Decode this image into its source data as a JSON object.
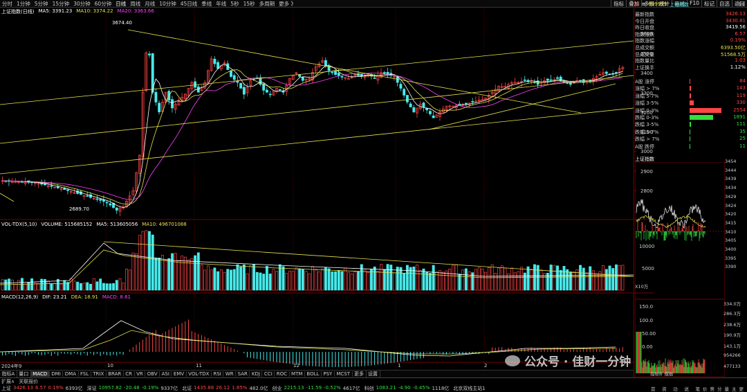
{
  "top_toolbar": {
    "periods": [
      "分时",
      "1分钟",
      "5分钟",
      "15分钟",
      "30分钟",
      "60分钟",
      "日线",
      "周线",
      "月线",
      "10分钟",
      "45日线",
      "季线",
      "年线",
      "5秒",
      "15秒",
      "多周期",
      "更多 》"
    ],
    "active": "日线",
    "right_buttons": [
      "指标",
      "叠加",
      "多股",
      "统计",
      "画线",
      "F10",
      "标记",
      "自选",
      "返回"
    ]
  },
  "main_chart": {
    "title": "上证指数(日线)",
    "ma5": "MA5: 3391.23",
    "ma10": "MA10: 3374.22",
    "ma20": "MA20: 3363.66",
    "high_label": "3674.40",
    "low_label": "2689.70",
    "y_ticks": [
      "3600",
      "3500",
      "3400",
      "3300",
      "3200",
      "3100",
      "3000",
      "2900",
      "2800"
    ]
  },
  "volume_chart": {
    "title": "VOL-TDX(5,10)",
    "volume": "VOLUME: 515685152",
    "ma5": "MA5: 513605056",
    "ma10": "MA10: 496701088",
    "y_ticks": [
      "10000",
      "5000"
    ],
    "unit": "X10万"
  },
  "macd_chart": {
    "title": "MACD(12,26,9)",
    "dif": "DIF: 23.21",
    "dea": "DEA: 18.91",
    "macd": "MACD: 8.61",
    "y_ticks": [
      "150.0",
      "100.0",
      "50.00",
      "0.00"
    ],
    "x_labels": [
      "2024年9",
      "10",
      "11",
      "12",
      "1",
      "2"
    ]
  },
  "right_panel": {
    "header_code": "999999",
    "header_name": "上证指数",
    "header_prefix": "G",
    "quote": [
      {
        "label": "最新指数",
        "value": "3426.13",
        "color": "red"
      },
      {
        "label": "今日开盘",
        "value": "3430.81",
        "color": "red"
      },
      {
        "label": "昨日收盘",
        "value": "3419.56",
        "color": "white"
      },
      {
        "label": "指数涨跌",
        "value": "6.57",
        "color": "red"
      },
      {
        "label": "指数涨幅",
        "value": "0.19%",
        "color": "red"
      },
      {
        "label": "总成交额",
        "value": "6393.50亿",
        "color": "yellow"
      },
      {
        "label": "总成交量",
        "value": "51568.5万",
        "color": "yellow"
      },
      {
        "label": "指数量比",
        "value": "1.03",
        "color": "red"
      },
      {
        "label": "上证换手",
        "value": "1.12%",
        "color": "white"
      }
    ],
    "breadth": [
      {
        "label": "A股 涨停",
        "value": "84",
        "color": "red",
        "bar": 0.03
      },
      {
        "label": "涨幅 > 7%",
        "value": "143",
        "color": "red",
        "bar": 0.05
      },
      {
        "label": "涨幅 5-7%",
        "value": "119",
        "color": "red",
        "bar": 0.04
      },
      {
        "label": "涨幅 3-5%",
        "value": "330",
        "color": "red",
        "bar": 0.12
      },
      {
        "label": "涨幅 0-3%",
        "value": "2554",
        "color": "red",
        "bar": 1.0
      },
      {
        "label": "跌幅 0-3%",
        "value": "1891",
        "color": "green",
        "bar": 0.74
      },
      {
        "label": "跌幅 3-5%",
        "value": "111",
        "color": "green",
        "bar": 0.04
      },
      {
        "label": "跌幅 5-7%",
        "value": "35",
        "color": "green",
        "bar": 0.01
      },
      {
        "label": "跌幅 > 7%",
        "value": "25",
        "color": "green",
        "bar": 0.01
      },
      {
        "label": "A股 跌停",
        "value": "11",
        "color": "green",
        "bar": 0.005
      }
    ],
    "mini_title": "上证指数",
    "mini_left_ticks": [
      "3454",
      "3444",
      "3439",
      "3434",
      "3429",
      "3424",
      "3420",
      "3415",
      "3410",
      "3405",
      "3400",
      "3395",
      "3390"
    ],
    "mini_vol_label": "334.0万",
    "mini_right_ticks": [
      "286.3万",
      "238.6万",
      "190.9万",
      "143.1万",
      "954266",
      "477133"
    ],
    "mini_tabs": [
      "指标B",
      "模板"
    ],
    "mini_bottom": [
      "首页",
      "资讯",
      "功能",
      "说明",
      "笔",
      "价",
      "势",
      "分",
      "量",
      "主",
      "更"
    ]
  },
  "bottom_tabs": {
    "left": "指标A",
    "items": [
      "量口",
      "MACD",
      "DMI",
      "DMA",
      "FSL",
      "TRIX",
      "BRAR",
      "CR",
      "VR",
      "OBV",
      "ASI",
      "EMV",
      "VOL-TDX",
      "RSI",
      "WR",
      "SAR",
      "KDJ",
      "CCI",
      "ROC",
      "MTM",
      "BOLL",
      "PSY",
      "MCST",
      "更多",
      "设置"
    ],
    "active": "MACD"
  },
  "status_bar": {
    "expand": "扩展∧",
    "related": "关联报价",
    "indices": [
      {
        "name": "上证",
        "price": "3426.13",
        "chg": "6.57",
        "pct": "0.19%",
        "amt": "6393亿",
        "dir": "up"
      },
      {
        "name": "深证",
        "price": "10957.82",
        "chg": "-20.48",
        "pct": "-0.19%",
        "amt": "9337亿",
        "dir": "down"
      },
      {
        "name": "北证",
        "price": "1435.88",
        "chg": "26.12",
        "pct": "1.85%",
        "amt": "482.0亿",
        "dir": "up"
      },
      {
        "name": "创业",
        "price": "2215.13",
        "chg": "-11.59",
        "pct": "-0.52%",
        "amt": "4617亿",
        "dir": "down"
      },
      {
        "name": "科创",
        "price": "1083.21",
        "chg": "-4.90",
        "pct": "-0.45%",
        "amt": "1118亿",
        "dir": "down"
      }
    ],
    "server": "北京双线主站1"
  },
  "watermark": "公众号 · 佳财一分钟"
}
